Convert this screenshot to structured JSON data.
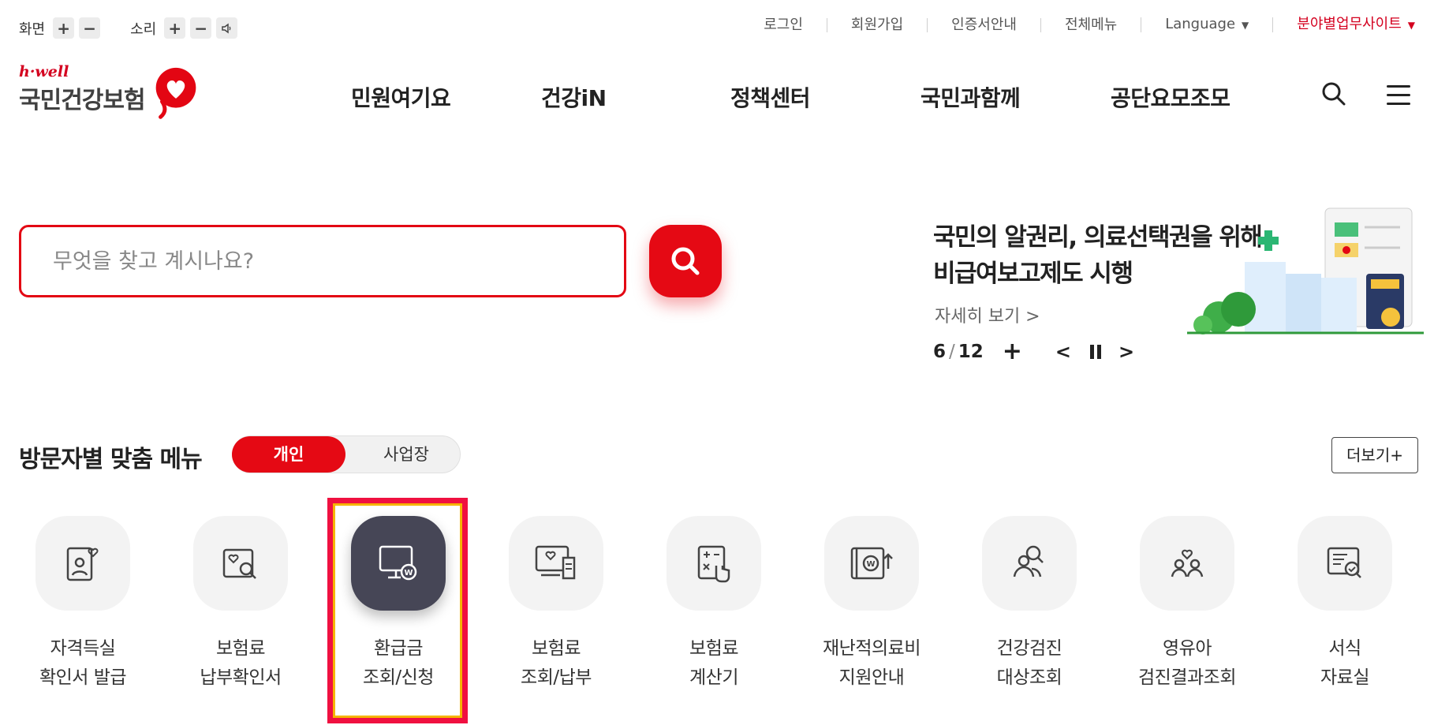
{
  "util": {
    "screen_label": "화면",
    "sound_label": "소리",
    "plus": "+",
    "minus": "−",
    "links": [
      "로그인",
      "회원가입",
      "인증서안내",
      "전체메뉴"
    ],
    "language": "Language",
    "field_site": "분야별업무사이트",
    "caret": "▼"
  },
  "logo": {
    "tagline": "h·well",
    "name": "국민건강보험"
  },
  "nav": [
    "민원여기요",
    "건강iN",
    "정책센터",
    "국민과함께",
    "공단요모조모"
  ],
  "search": {
    "placeholder": "무엇을 찾고 계시나요?",
    "value": ""
  },
  "banner": {
    "title_line1": "국민의 알권리, 의료선택권을 위해",
    "title_line2": "비급여보고제도 시행",
    "more": "자세히 보기 >",
    "current": "6",
    "sep": "/",
    "total": "12",
    "plus": "+",
    "prev": "<",
    "next": ">"
  },
  "custom_menu": {
    "title": "방문자별 맞춤 메뉴",
    "tab_personal": "개인",
    "tab_business": "사업장",
    "more": "더보기+",
    "items": [
      {
        "line1": "자격득실",
        "line2": "확인서 발급",
        "icon": "id-card-heart-icon"
      },
      {
        "line1": "보험료",
        "line2": "납부확인서",
        "icon": "document-search-icon"
      },
      {
        "line1": "환급금",
        "line2": "조회/신청",
        "icon": "monitor-won-icon"
      },
      {
        "line1": "보험료",
        "line2": "조회/납부",
        "icon": "monitor-receipt-icon"
      },
      {
        "line1": "보험료",
        "line2": "계산기",
        "icon": "calculator-hand-icon"
      },
      {
        "line1": "재난적의료비",
        "line2": "지원안내",
        "icon": "wallet-won-icon"
      },
      {
        "line1": "건강검진",
        "line2": "대상조회",
        "icon": "people-search-icon"
      },
      {
        "line1": "영유아",
        "line2": "검진결과조회",
        "icon": "family-heart-icon"
      },
      {
        "line1": "서식",
        "line2": "자료실",
        "icon": "form-check-icon"
      }
    ]
  },
  "colors": {
    "brand_red": "#e50914",
    "active_icon_bg": "#464656",
    "highlight_border": "#f01040"
  }
}
